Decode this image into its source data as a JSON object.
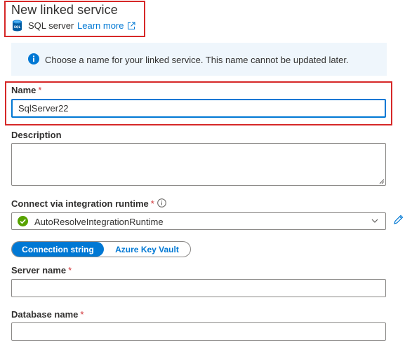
{
  "header": {
    "title": "New linked service",
    "service_type_icon": "sql-database-icon",
    "service_type": "SQL server",
    "learn_more": "Learn more",
    "external_link_icon": "external-link-icon"
  },
  "info_banner": {
    "icon": "info-icon",
    "text": "Choose a name for your linked service. This name cannot be updated later."
  },
  "form": {
    "name": {
      "label": "Name",
      "required_marker": "*",
      "value": "SqlServer22"
    },
    "description": {
      "label": "Description",
      "value": ""
    },
    "integration_runtime": {
      "label": "Connect via integration runtime",
      "required_marker": "*",
      "info_icon": "info-circle-icon",
      "selected": "AutoResolveIntegrationRuntime",
      "status_icon": "check-circle-icon",
      "edit_icon": "pencil-icon"
    },
    "auth_toggle": {
      "options": [
        "Connection string",
        "Azure Key Vault"
      ],
      "selected": "Connection string"
    },
    "server_name": {
      "label": "Server name",
      "required_marker": "*",
      "value": ""
    },
    "database_name": {
      "label": "Database name",
      "required_marker": "*",
      "value": ""
    }
  },
  "colors": {
    "accent": "#0078d4",
    "highlight_border": "#d62828",
    "required": "#d13438",
    "success": "#57a300",
    "banner_bg": "#eff6fc"
  }
}
